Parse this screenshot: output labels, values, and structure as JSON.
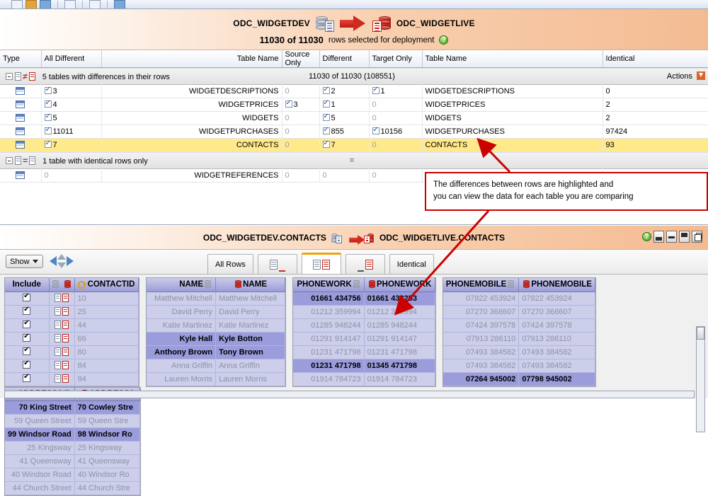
{
  "banner": {
    "source_db": "ODC_WIDGETDEV",
    "target_db": "ODC_WIDGETLIVE",
    "rows_count": "11030 of 11030",
    "rows_label": "rows selected for deployment",
    "help_glyph": "?"
  },
  "top_grid": {
    "headers": [
      "Type",
      "All Different",
      "Table Name",
      "Source Only",
      "Different",
      "Target Only",
      "Table Name",
      "Identical"
    ],
    "groups": [
      {
        "label": "5 tables with differences in their rows",
        "summary": "11030 of 11030 (108551)",
        "actions_label": "Actions",
        "rows": [
          {
            "all_different": "3",
            "all_checked": true,
            "source_table": "WIDGETDESCRIPTIONS",
            "source_only": "0",
            "source_only_checked": false,
            "different": "2",
            "different_checked": true,
            "target_only": "1",
            "target_only_checked": true,
            "target_table": "WIDGETDESCRIPTIONS",
            "identical": "0",
            "selected": false
          },
          {
            "all_different": "4",
            "all_checked": true,
            "source_table": "WIDGETPRICES",
            "source_only": "3",
            "source_only_checked": true,
            "different": "1",
            "different_checked": true,
            "target_only": "0",
            "target_only_checked": false,
            "target_table": "WIDGETPRICES",
            "identical": "2",
            "selected": false
          },
          {
            "all_different": "5",
            "all_checked": true,
            "source_table": "WIDGETS",
            "source_only": "0",
            "source_only_checked": false,
            "different": "5",
            "different_checked": true,
            "target_only": "0",
            "target_only_checked": false,
            "target_table": "WIDGETS",
            "identical": "2",
            "selected": false
          },
          {
            "all_different": "11011",
            "all_checked": true,
            "source_table": "WIDGETPURCHASES",
            "source_only": "0",
            "source_only_checked": false,
            "different": "855",
            "different_checked": true,
            "target_only": "10156",
            "target_only_checked": true,
            "target_table": "WIDGETPURCHASES",
            "identical": "97424",
            "selected": false
          },
          {
            "all_different": "7",
            "all_checked": true,
            "source_table": "CONTACTS",
            "source_only": "0",
            "source_only_checked": false,
            "different": "7",
            "different_checked": true,
            "target_only": "0",
            "target_only_checked": false,
            "target_table": "CONTACTS",
            "identical": "93",
            "selected": true
          }
        ]
      },
      {
        "label": "1 table with identical rows only",
        "summary": "=",
        "rows": [
          {
            "all_different": "0",
            "all_checked": false,
            "source_table": "WIDGETREFERENCES",
            "source_only": "0",
            "source_only_checked": false,
            "different": "0",
            "different_checked": false,
            "target_only": "0",
            "target_only_checked": false,
            "target_table": "",
            "identical": "",
            "selected": false
          }
        ]
      }
    ]
  },
  "callout": {
    "line1": "The differences between rows are highlighted and",
    "line2": "you can view the data for each table you are comparing",
    "border_color": "#cc0000"
  },
  "panel2": {
    "source_title": "ODC_WIDGETDEV.CONTACTS",
    "target_title": "ODC_WIDGETLIVE.CONTACTS",
    "help_glyph": "?",
    "show_label": "Show",
    "tabs": [
      {
        "label": "All Rows",
        "active": false,
        "kind": "text"
      },
      {
        "label": "",
        "active": false,
        "kind": "source-only"
      },
      {
        "label": "",
        "active": true,
        "kind": "different"
      },
      {
        "label": "",
        "active": false,
        "kind": "target-only"
      },
      {
        "label": "Identical",
        "active": false,
        "kind": "text"
      }
    ]
  },
  "data_grid": {
    "include_header": "Include",
    "key_header": "CONTACTID",
    "column_groups": [
      {
        "source_header": "NAME",
        "target_header": "NAME"
      },
      {
        "source_header": "PHONEWORK",
        "target_header": "PHONEWORK"
      },
      {
        "source_header": "PHONEMOBILE",
        "target_header": "PHONEMOBILE"
      },
      {
        "source_header": "ADDRESS1",
        "target_header": "ADDRESS1"
      }
    ],
    "rows": [
      {
        "include": true,
        "id": "10",
        "name_src": "Matthew Mitchell",
        "name_tgt": "Matthew Mitchell",
        "name_diff": false,
        "work_src": "01661 434756",
        "work_tgt": "01661 433253",
        "work_diff": true,
        "mob_src": "07822 453924",
        "mob_tgt": "07822 453924",
        "mob_diff": false,
        "addr_src": "70 King Street",
        "addr_tgt": "70 Cowley Stre",
        "addr_diff": true
      },
      {
        "include": true,
        "id": "25",
        "name_src": "David Perry",
        "name_tgt": "David Perry",
        "name_diff": false,
        "work_src": "01212 359994",
        "work_tgt": "01212 359994",
        "work_diff": false,
        "mob_src": "07270 368607",
        "mob_tgt": "07270 368607",
        "mob_diff": false,
        "addr_src": "59 Queen Street",
        "addr_tgt": "59 Queen Stre",
        "addr_diff": false
      },
      {
        "include": true,
        "id": "44",
        "name_src": "Katie Martinez",
        "name_tgt": "Katie Martinez",
        "name_diff": false,
        "work_src": "01285 948244",
        "work_tgt": "01285 948244",
        "work_diff": false,
        "mob_src": "07424 397578",
        "mob_tgt": "07424 397578",
        "mob_diff": false,
        "addr_src": "99 Windsor Road",
        "addr_tgt": "98 Windsor Ro",
        "addr_diff": true
      },
      {
        "include": true,
        "id": "66",
        "name_src": "Kyle Hall",
        "name_tgt": "Kyle Botton",
        "name_diff": true,
        "work_src": "01291 914147",
        "work_tgt": "01291 914147",
        "work_diff": false,
        "mob_src": "07913 286110",
        "mob_tgt": "07913 286110",
        "mob_diff": false,
        "addr_src": "25 Kingsway",
        "addr_tgt": "25 Kingsway",
        "addr_diff": false
      },
      {
        "include": true,
        "id": "80",
        "name_src": "Anthony Brown",
        "name_tgt": "Tony Brown",
        "name_diff": true,
        "work_src": "01231 471798",
        "work_tgt": "01231 471798",
        "work_diff": false,
        "mob_src": "07493 384582",
        "mob_tgt": "07493 384582",
        "mob_diff": false,
        "addr_src": "41 Queensway",
        "addr_tgt": "41 Queensway",
        "addr_diff": false
      },
      {
        "include": true,
        "id": "84",
        "name_src": "Anna Griffin",
        "name_tgt": "Anna Griffin",
        "name_diff": false,
        "work_src": "01231 471798",
        "work_tgt": "01345 471798",
        "work_diff": true,
        "mob_src": "07493 384582",
        "mob_tgt": "07493 384582",
        "mob_diff": false,
        "addr_src": "40 Windsor Road",
        "addr_tgt": "40 Windsor Ro",
        "addr_diff": false
      },
      {
        "include": true,
        "id": "94",
        "name_src": "Lauren Morris",
        "name_tgt": "Lauren Morris",
        "name_diff": false,
        "work_src": "01914 784723",
        "work_tgt": "01914 784723",
        "work_diff": false,
        "mob_src": "07264 945002",
        "mob_tgt": "07798 945002",
        "mob_diff": true,
        "addr_src": "44 Church Street",
        "addr_tgt": "44 Church Stre",
        "addr_diff": false
      }
    ]
  }
}
